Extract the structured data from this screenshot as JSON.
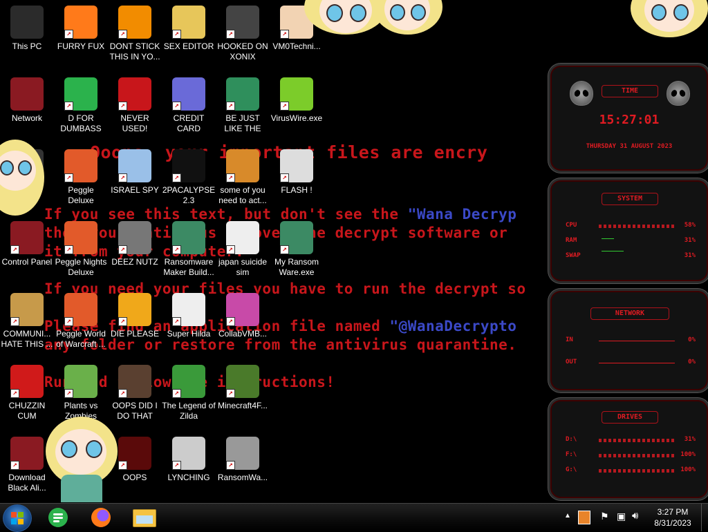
{
  "wallpaper": {
    "title": "Ooops, your important files are encry",
    "line1_a": "If you see this text, but don't see the ",
    "line1_b": "\"Wana Decryp",
    "line2": "then your antivirus removed the decrypt software or",
    "line3": "it from your computer.",
    "line4": "If you need your files you have to run the decrypt so",
    "line5_a": "Please find an application file named ",
    "line5_b": "\"@WanaDecrypto",
    "line6": "any folder or restore from the antivirus quarantine.",
    "line7": "Run and follow the instructions!"
  },
  "desktop_icons": [
    {
      "label": "This PC",
      "icon": "computer-icon",
      "color": "#2b2b2b"
    },
    {
      "label": "FURRY FUX",
      "icon": "firefox-icon",
      "color": "#ff7a1a"
    },
    {
      "label": "DONT STICK THIS IN YO...",
      "icon": "vlc-cone-icon",
      "color": "#f28c00"
    },
    {
      "label": "SEX EDITOR",
      "icon": "hex-editor-icon",
      "color": "#e7c65a"
    },
    {
      "label": "HOOKED ON XONIX",
      "icon": "xonix-game-icon",
      "color": "#444"
    },
    {
      "label": "VM0Techni...",
      "icon": "doctor-icon",
      "color": "#f2d3b3"
    },
    {
      "label": "Network",
      "icon": "alien-network-icon",
      "color": "#8a1a22"
    },
    {
      "label": "D FOR DUMBASS",
      "icon": "feedly-icon",
      "color": "#2bb24c"
    },
    {
      "label": "NEVER USED!",
      "icon": "dev-cpp-icon",
      "color": "#c8161b"
    },
    {
      "label": "CREDIT CARD CHECKER",
      "icon": "credit-card-icon",
      "color": "#6a6ad8"
    },
    {
      "label": "BE JUST LIKE THE DUDE!",
      "icon": "gnome-santa-icon",
      "color": "#2f8f5c"
    },
    {
      "label": "VirusWire.exe",
      "icon": "lime-icon",
      "color": "#7ccc2a"
    },
    {
      "label": "in",
      "icon": "recycle-bin-icon",
      "color": "#333"
    },
    {
      "label": "Peggle Deluxe",
      "icon": "peggle-icon",
      "color": "#e25a2a"
    },
    {
      "label": "ISRAEL SPY",
      "icon": "network-spy-icon",
      "color": "#9ac0e8"
    },
    {
      "label": "2PACALYPSE 2.3",
      "icon": "terminal-icon",
      "color": "#111"
    },
    {
      "label": "some of you need to act...",
      "icon": "cartoon-dog-icon",
      "color": "#d88a2a"
    },
    {
      "label": "FLASH !",
      "icon": "flash-doc-icon",
      "color": "#ddd"
    },
    {
      "label": "Control Panel",
      "icon": "control-panel-icon",
      "color": "#8a1a22"
    },
    {
      "label": "Peggle Nights Deluxe",
      "icon": "peggle-nights-icon",
      "color": "#e25a2a"
    },
    {
      "label": "DEEZ NUTZ",
      "icon": "stacked-windows-icon",
      "color": "#777"
    },
    {
      "label": "Ransomware Maker Build...",
      "icon": "app-window-icon",
      "color": "#3c8a64"
    },
    {
      "label": "japan suicide sim",
      "icon": "document-icon",
      "color": "#eee"
    },
    {
      "label": "My Ransom Ware.exe",
      "icon": "app-window-icon",
      "color": "#3c8a64"
    },
    {
      "label": "COMMUNI... HATE THIS ...",
      "icon": "money-bag-icon",
      "color": "#c79a4a"
    },
    {
      "label": "Peggle World of Warcraft ...",
      "icon": "peggle-wow-icon",
      "color": "#e25a2a"
    },
    {
      "label": "DIE PLEASE",
      "icon": "de-app-icon",
      "color": "#f0a81a"
    },
    {
      "label": "Super Hilda",
      "icon": "pixel-art-icon",
      "color": "#eee"
    },
    {
      "label": "CollabVMB...",
      "icon": "monitor-icon",
      "color": "#c84aa8"
    },
    {
      "label": "",
      "icon": "",
      "color": ""
    },
    {
      "label": "CHUZZIN CUM",
      "icon": "chuzzle-icon",
      "color": "#d01a1a"
    },
    {
      "label": "Plants vs Zombies",
      "icon": "flower-icon",
      "color": "#6ab04a"
    },
    {
      "label": "OOPS DID I DO THAT",
      "icon": "portrait-icon",
      "color": "#5a4030"
    },
    {
      "label": "The Legend of Zilda",
      "icon": "zelda-icon",
      "color": "#3a9a3a"
    },
    {
      "label": "Minecraft4F...",
      "icon": "grass-block-icon",
      "color": "#4a7a2a"
    },
    {
      "label": "",
      "icon": "",
      "color": ""
    },
    {
      "label": "Download Black Ali...",
      "icon": "alien-icon",
      "color": "#8a1a22"
    },
    {
      "label": "",
      "icon": "",
      "color": ""
    },
    {
      "label": "OOPS",
      "icon": "red-skull-icon",
      "color": "#5a0a0a"
    },
    {
      "label": "LYNCHING",
      "icon": "arcane-symbol-icon",
      "color": "#ccc"
    },
    {
      "label": "RansomWa...",
      "icon": "skull-ring-icon",
      "color": "#999"
    },
    {
      "label": "",
      "icon": "",
      "color": ""
    }
  ],
  "gadget": {
    "time_title": "TIME",
    "time": "15:27:01",
    "date": "THURSDAY 31 AUGUST 2023",
    "system_title": "SYSTEM",
    "cpu_label": "CPU",
    "cpu_value": "58%",
    "ram_label": "RAM",
    "ram_value": "31%",
    "swap_label": "SWAP",
    "swap_value": "31%",
    "network_title": "NETWORK",
    "in_label": "IN",
    "in_value": "0%",
    "out_label": "OUT",
    "out_value": "0%",
    "drives_title": "DRIVES",
    "drives": [
      {
        "label": "D:\\",
        "value": "31%"
      },
      {
        "label": "F:\\",
        "value": "100%"
      },
      {
        "label": "G:\\",
        "value": "100%"
      }
    ],
    "accent": "#e01b22"
  },
  "taskbar": {
    "clock_time": "3:27 PM",
    "clock_date": "8/31/2023",
    "pinned": [
      "feedly-icon",
      "firefox-icon",
      "file-explorer-icon"
    ]
  }
}
